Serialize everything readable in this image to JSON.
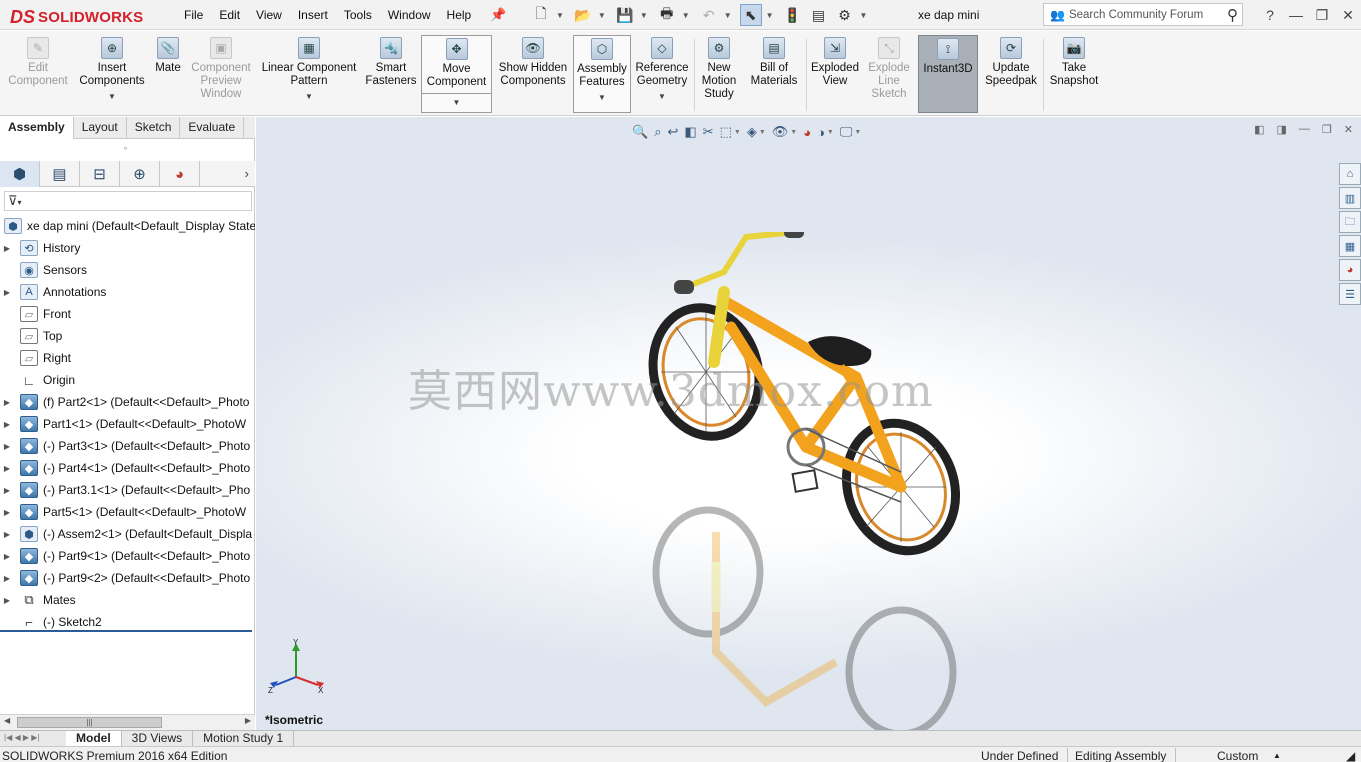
{
  "app": {
    "brand_mark": "DS",
    "brand_name": "SOLIDWORKS"
  },
  "menu": [
    "File",
    "Edit",
    "View",
    "Insert",
    "Tools",
    "Window",
    "Help"
  ],
  "document_title": "xe dap mini",
  "search": {
    "placeholder": "Search Community Forum"
  },
  "window_controls": {
    "help": "?",
    "minimize": "—",
    "restore": "❐",
    "close": "✕"
  },
  "commands": {
    "edit_component": "Edit Component",
    "insert_components": "Insert Components",
    "mate": "Mate",
    "component_preview": "Component Preview Window",
    "linear_pattern": "Linear Component Pattern",
    "smart_fasteners": "Smart Fasteners",
    "move_component": "Move Component",
    "show_hidden": "Show Hidden Components",
    "assembly_features": "Assembly Features",
    "reference_geometry": "Reference Geometry",
    "new_motion_study": "New Motion Study",
    "bill_of_materials": "Bill of Materials",
    "exploded_view": "Exploded View",
    "explode_line_sketch": "Explode Line Sketch",
    "instant3d": "Instant3D",
    "update_speedpak": "Update Speedpak",
    "take_snapshot": "Take Snapshot"
  },
  "cm_tabs": [
    "Assembly",
    "Layout",
    "Sketch",
    "Evaluate"
  ],
  "tree": {
    "root": "xe dap mini  (Default<Default_Display State",
    "items": [
      "History",
      "Sensors",
      "Annotations",
      "Front",
      "Top",
      "Right",
      "Origin",
      "(f) Part2<1> (Default<<Default>_Photo",
      "Part1<1> (Default<<Default>_PhotoW",
      "(-) Part3<1> (Default<<Default>_Photo",
      "(-) Part4<1> (Default<<Default>_Photo",
      "(-) Part3.1<1> (Default<<Default>_Pho",
      "Part5<1> (Default<<Default>_PhotoW",
      "(-) Assem2<1> (Default<Default_Displa",
      "(-) Part9<1> (Default<<Default>_Photo",
      "(-) Part9<2> (Default<<Default>_Photo",
      "Mates",
      "(-) Sketch2"
    ]
  },
  "viewport": {
    "watermark": "莫西网www.3dmox.com",
    "view_name": "*Isometric",
    "triad": {
      "x": "X",
      "y": "Y",
      "z": "Z"
    }
  },
  "bottom_tabs": [
    "Model",
    "3D Views",
    "Motion Study 1"
  ],
  "status": {
    "edition": "SOLIDWORKS Premium 2016 x64 Edition",
    "state": "Under Defined",
    "mode": "Editing Assembly",
    "units": "Custom"
  },
  "colors": {
    "brand": "#d4202a",
    "bike_frame": "#f2a21c",
    "active_tool": "#a9b0b7"
  }
}
